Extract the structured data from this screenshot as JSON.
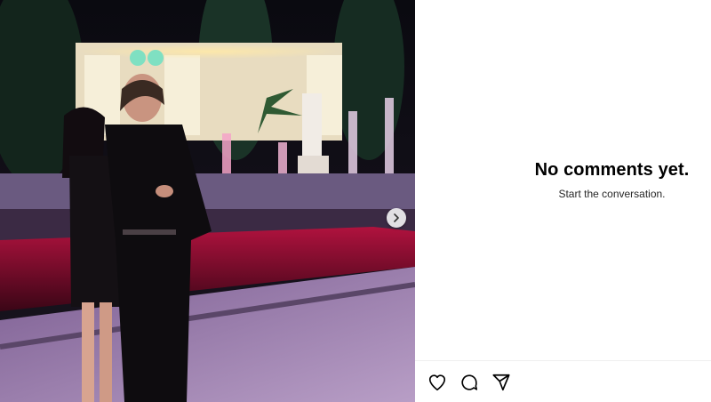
{
  "post": {
    "image_alt": "Couple posing in front of illuminated fountains at night"
  },
  "carousel": {
    "next_icon": "chevron-right-icon"
  },
  "comments": {
    "empty_title": "No comments yet.",
    "empty_subtitle": "Start the conversation."
  },
  "actions": {
    "like_icon": "heart-icon",
    "comment_icon": "comment-icon",
    "share_icon": "paper-plane-icon"
  }
}
